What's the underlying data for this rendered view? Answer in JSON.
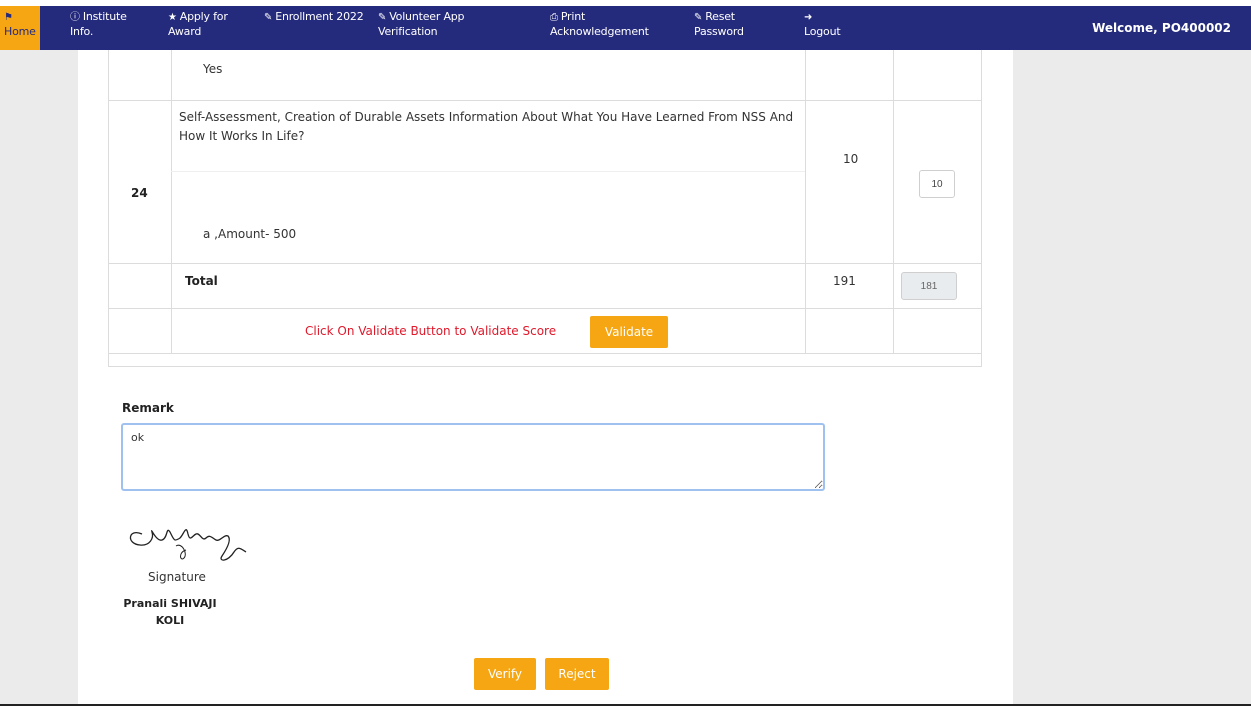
{
  "nav": {
    "items": [
      {
        "label": "Home"
      },
      {
        "label": "Institute Info."
      },
      {
        "label": "Apply for Award"
      },
      {
        "label": "Enrollment 2022"
      },
      {
        "label": "Volunteer App Verification"
      },
      {
        "label": "Print Acknowledgement"
      },
      {
        "label": "Reset Password"
      },
      {
        "label": "Logout"
      }
    ],
    "welcome": "Welcome, PO400002"
  },
  "table": {
    "prev_answer": "Yes",
    "row24": {
      "sr_no": "24",
      "question": "Self-Assessment, Creation of Durable Assets Information About What You Have Learned From NSS And How It Works In Life?",
      "answer": "a ,Amount- 500",
      "max_marks": "10",
      "score_value": "10"
    },
    "total": {
      "label": "Total",
      "max_total": "191",
      "score_total": "181"
    },
    "validate": {
      "message": "Click On Validate Button to Validate Score",
      "button_label": "Validate"
    }
  },
  "remark": {
    "label": "Remark",
    "value": "ok"
  },
  "signature": {
    "caption": "Signature",
    "name": "Pranali SHIVAJI KOLI"
  },
  "actions": {
    "verify_label": "Verify",
    "reject_label": "Reject"
  },
  "colors": {
    "navbar": "#242a7c",
    "accent": "#f6a613",
    "warning_text": "#e0192b"
  }
}
